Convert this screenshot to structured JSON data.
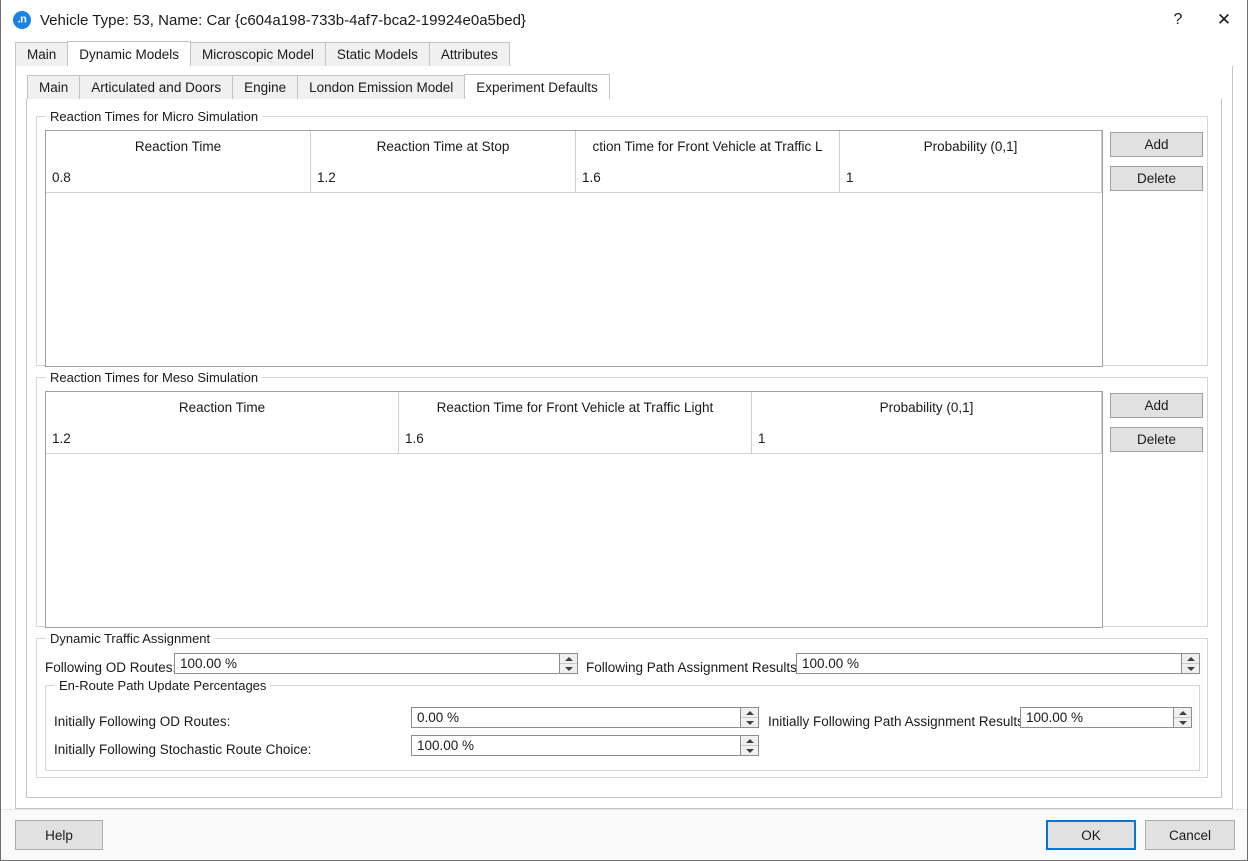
{
  "window": {
    "title": "Vehicle Type: 53, Name: Car  {c604a198-733b-4af7-bca2-19924e0a5bed}",
    "app_icon_text": ".n",
    "help_glyph": "?",
    "close_glyph": "✕"
  },
  "outer_tabs": [
    {
      "label": "Main",
      "selected": false
    },
    {
      "label": "Dynamic Models",
      "selected": true
    },
    {
      "label": "Microscopic Model",
      "selected": false
    },
    {
      "label": "Static Models",
      "selected": false
    },
    {
      "label": "Attributes",
      "selected": false
    }
  ],
  "inner_tabs": [
    {
      "label": "Main",
      "selected": false
    },
    {
      "label": "Articulated and Doors",
      "selected": false
    },
    {
      "label": "Engine",
      "selected": false
    },
    {
      "label": "London Emission Model",
      "selected": false
    },
    {
      "label": "Experiment Defaults",
      "selected": true
    }
  ],
  "micro_group": {
    "title": "Reaction Times for Micro Simulation",
    "columns": [
      "Reaction Time",
      "Reaction Time at Stop",
      "ction Time for Front Vehicle at Traffic L",
      "Probability (0,1]"
    ],
    "rows": [
      [
        "0.8",
        "1.2",
        "1.6",
        "1"
      ]
    ],
    "add_label": "Add",
    "delete_label": "Delete"
  },
  "meso_group": {
    "title": "Reaction Times for Meso Simulation",
    "columns": [
      "Reaction Time",
      "Reaction Time for Front Vehicle at Traffic Light",
      "Probability (0,1]"
    ],
    "rows": [
      [
        "1.2",
        "1.6",
        "1"
      ]
    ],
    "add_label": "Add",
    "delete_label": "Delete"
  },
  "dta_group": {
    "title": "Dynamic Traffic Assignment",
    "following_od_routes_label": "Following OD Routes:",
    "following_od_routes_value": "100.00 %",
    "following_path_assignment_label": "Following Path Assignment Results:",
    "following_path_assignment_value": "100.00 %",
    "enroute": {
      "title": "En-Route Path Update Percentages",
      "initially_od_routes_label": "Initially Following OD Routes:",
      "initially_od_routes_value": "0.00 %",
      "initially_path_assignment_label": "Initially Following Path Assignment Results:",
      "initially_path_assignment_value": "100.00 %",
      "initially_stochastic_label": "Initially Following Stochastic Route Choice:",
      "initially_stochastic_value": "100.00 %"
    }
  },
  "footer": {
    "help_label": "Help",
    "ok_label": "OK",
    "cancel_label": "Cancel"
  },
  "colors": {
    "accent": "#0078d7",
    "tab_inactive": "#f0f0f0",
    "button_face": "#e1e1e1"
  }
}
